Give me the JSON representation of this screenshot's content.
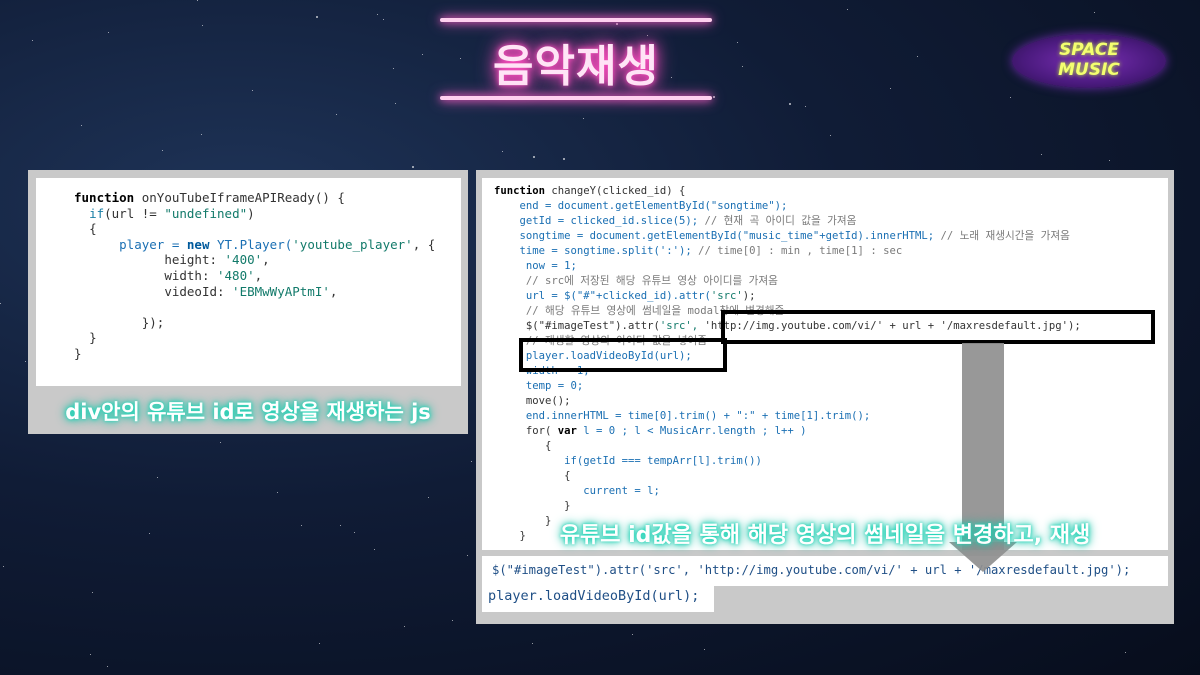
{
  "title": "음악재생",
  "logo": {
    "line1": "SPACE",
    "line2": "MUSIC"
  },
  "left_panel": {
    "code": {
      "l1_kw": "function",
      "l1_rest": " onYouTubeIframeAPIReady() {",
      "l2_kw": "if",
      "l2_a": "(url != ",
      "l2_str": "\"undefined\"",
      "l2_b": ")",
      "l3": "{",
      "l4_a": "player = ",
      "l4_new": "new",
      "l4_b": " YT.Player(",
      "l4_str": "'youtube_player'",
      "l4_c": ", {",
      "l5_a": "height: ",
      "l5_str": "'400'",
      "l5_b": ",",
      "l6_a": "width: ",
      "l6_str": "'480'",
      "l6_b": ",",
      "l7_a": "videoId: ",
      "l7_str": "'EBMwWyAPtmI'",
      "l7_b": ",",
      "l8": "});",
      "l9": "}",
      "l10": "}"
    },
    "caption": "div안의 유튜브 id로 영상을 재생하는 js"
  },
  "right_panel": {
    "code": {
      "r1_kw": "function",
      "r1_rest": " changeY(clicked_id) {",
      "r2": "end = document.getElementById(\"songtime\");",
      "r3_a": "getId = clicked_id.slice(5); ",
      "r3_cm": "// 현재 곡 아이디 값을 가져옴",
      "r4_a": "songtime = document.getElementById(\"music_time\"+getId).innerHTML; ",
      "r4_cm": "// 노래 재생시간을 가져옴",
      "r5_a": "time = songtime.split(':'); ",
      "r5_cm": "// time[0] : min , time[1] : sec",
      "r6": "now = 1;",
      "r7": "// src에 저장된 해당 유튜브 영상 아이디를 가져옴",
      "r8_a": "url = $(\"#\"+clicked_id).attr(",
      "r8_str": "'src'",
      "r8_b": ");",
      "r9": "// 해당 유튜브 영상에 썸네일을 modal창에 변경해줌",
      "r10_a": "$(\"#imageTest\").attr(",
      "r10_str": "'src', ",
      "r10_b": "'http://img.youtube.com/vi/' + url + '/maxresdefault.jpg');",
      "r11": "// 재생할 영상의 아이디 값을 넣어줌",
      "r12": "player.loadVideoById(url);",
      "r13": "width = 1;",
      "r14": "temp = 0;",
      "r15": "move();",
      "r16": "end.innerHTML = time[0].trim() + \":\" + time[1].trim();",
      "r17_a": "for( ",
      "r17_var": "var",
      "r17_b": " l = 0 ; l < MusicArr.length ; l++ )",
      "r18": "{",
      "r19": "if(getId === tempArr[l].trim())",
      "r20": "{",
      "r21": "current = l;",
      "r22": "}",
      "r23": "}",
      "r24": "}"
    },
    "caption": "유튜브 id값을 통해 해당 영상의 썸네일을 변경하고, 재생",
    "bottom_line1": "$(\"#imageTest\").attr('src', 'http://img.youtube.com/vi/' + url + '/maxresdefault.jpg');",
    "bottom_line2": "player.loadVideoById(url);"
  }
}
